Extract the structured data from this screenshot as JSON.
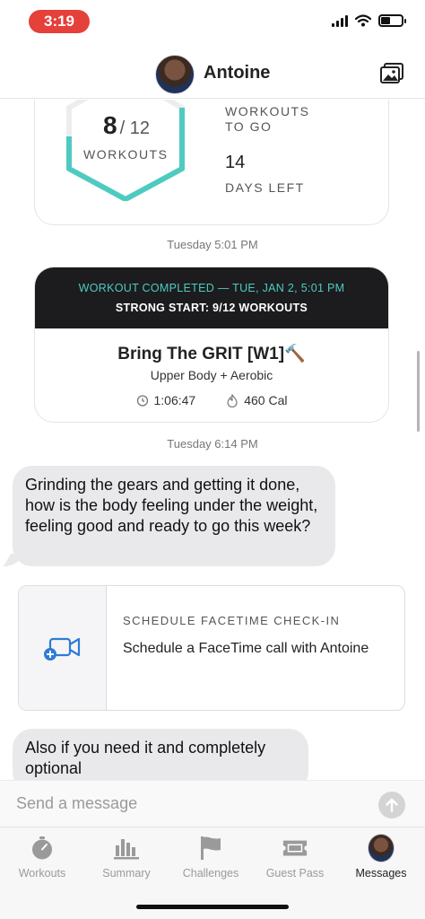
{
  "status_bar": {
    "time": "3:19"
  },
  "header": {
    "name": "Antoine",
    "gallery_icon": "photo-gallery-icon"
  },
  "progress_card": {
    "workouts_done": "8",
    "workouts_total": "/ 12",
    "workouts_label": "WORKOUTS",
    "to_go_label": "WORKOUTS TO GO",
    "days_left_value": "14",
    "days_left_label": "DAYS LEFT",
    "ring_color": "#4ecbc0"
  },
  "timestamp_1": "Tuesday 5:01 PM",
  "workout_card": {
    "completed_line": "WORKOUT COMPLETED — TUE, JAN 2, 5:01 PM",
    "program_line": "STRONG START: 9/12 WORKOUTS",
    "title": "Bring The GRIT [W1]🔨",
    "subtitle": "Upper Body + Aerobic",
    "duration": "1:06:47",
    "calories": "460 Cal"
  },
  "timestamp_2": "Tuesday 6:14 PM",
  "message_1": "Grinding the gears and getting it done, how is the body feeling under the weight, feeling good and ready to go this week?",
  "facetime_card": {
    "title": "SCHEDULE FACETIME CHECK-IN",
    "description": "Schedule a FaceTime call with Antoine",
    "icon": "video-add-icon"
  },
  "message_2": "Also if you need it and completely optional",
  "composer": {
    "placeholder": "Send a message"
  },
  "tabs": [
    {
      "label": "Workouts",
      "icon": "stopwatch-icon"
    },
    {
      "label": "Summary",
      "icon": "bar-chart-icon"
    },
    {
      "label": "Challenges",
      "icon": "flag-icon"
    },
    {
      "label": "Guest Pass",
      "icon": "ticket-icon"
    },
    {
      "label": "Messages",
      "icon": "avatar"
    }
  ],
  "colors": {
    "accent": "#4ecbc0",
    "time_pill": "#e5403a",
    "band": "#1c1c1e",
    "bubble": "#e9e9eb"
  }
}
